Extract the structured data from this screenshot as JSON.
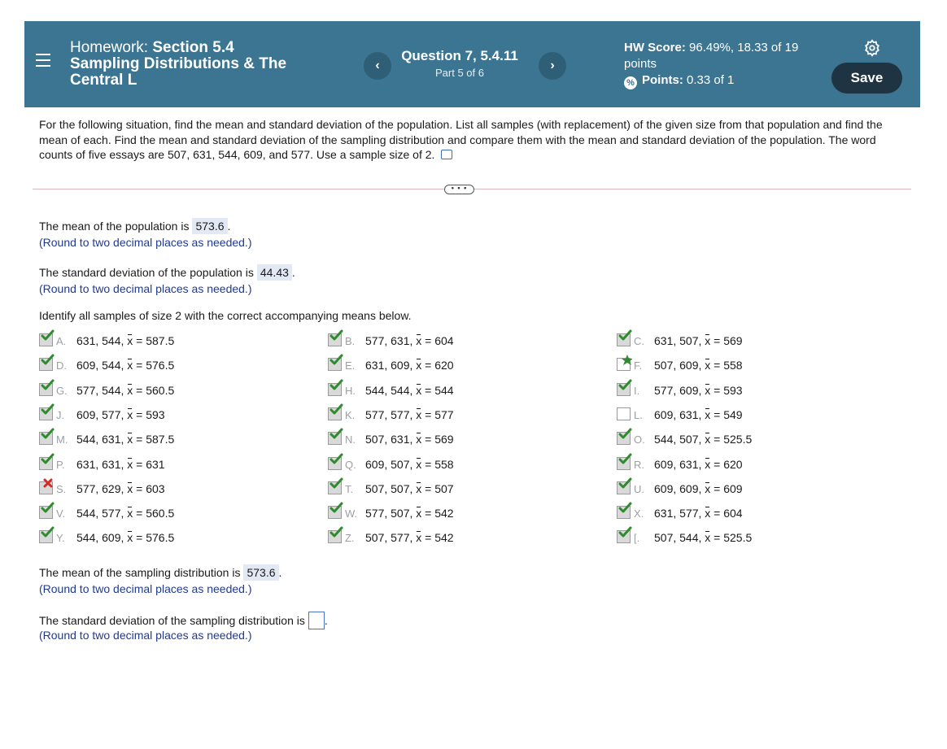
{
  "header": {
    "hw_prefix": "Homework: ",
    "hw_section": "Section 5.4",
    "hw_subtitle": "Sampling Distributions & The Central L",
    "question_title": "Question 7, 5.4.11",
    "question_part": "Part 5 of 6",
    "prev_label": "‹",
    "next_label": "›",
    "score_label": "HW Score:",
    "score_value": "96.49%, 18.33 of 19 points",
    "points_label": "Points:",
    "points_value": "0.33 of 1",
    "save_label": "Save"
  },
  "question_text": "For the following situation, find the mean and standard deviation of the population. List all samples (with replacement) of the given size from that population and find the mean of each. Find the mean and standard deviation of the sampling distribution and compare them with the mean and standard deviation of the population. The word counts of five essays are 507, 631, 544, 609, and 577. Use a sample size of 2.",
  "more_label": "• • •",
  "pop_mean": {
    "prefix": "The mean of the population is",
    "value": "573.6",
    "hint": "(Round to two decimal places as needed.)"
  },
  "pop_sd": {
    "prefix": "The standard deviation of the population is",
    "value": "44.43",
    "hint": "(Round to two decimal places as needed.)"
  },
  "identify_prompt": "Identify all samples of size 2 with the correct accompanying means below.",
  "choices": [
    {
      "letter": "A.",
      "nums": "631, 544,",
      "mean": "= 587.5",
      "state": "checked"
    },
    {
      "letter": "B.",
      "nums": "577, 631,",
      "mean": "= 604",
      "state": "checked"
    },
    {
      "letter": "C.",
      "nums": "631, 507,",
      "mean": "= 569",
      "state": "checked"
    },
    {
      "letter": "D.",
      "nums": "609, 544,",
      "mean": "= 576.5",
      "state": "checked"
    },
    {
      "letter": "E.",
      "nums": "631, 609,",
      "mean": "= 620",
      "state": "checked"
    },
    {
      "letter": "F.",
      "nums": "507, 609,",
      "mean": "= 558",
      "state": "star"
    },
    {
      "letter": "G.",
      "nums": "577, 544,",
      "mean": "= 560.5",
      "state": "checked"
    },
    {
      "letter": "H.",
      "nums": "544, 544,",
      "mean": "= 544",
      "state": "checked"
    },
    {
      "letter": "I.",
      "nums": "577, 609,",
      "mean": "= 593",
      "state": "checked"
    },
    {
      "letter": "J.",
      "nums": "609, 577,",
      "mean": "= 593",
      "state": "checked"
    },
    {
      "letter": "K.",
      "nums": "577, 577,",
      "mean": "= 577",
      "state": "checked"
    },
    {
      "letter": "L.",
      "nums": "609, 631,",
      "mean": "= 549",
      "state": "empty"
    },
    {
      "letter": "M.",
      "nums": "544, 631,",
      "mean": "= 587.5",
      "state": "checked"
    },
    {
      "letter": "N.",
      "nums": "507, 631,",
      "mean": "= 569",
      "state": "checked"
    },
    {
      "letter": "O.",
      "nums": "544, 507,",
      "mean": "= 525.5",
      "state": "checked"
    },
    {
      "letter": "P.",
      "nums": "631, 631,",
      "mean": "= 631",
      "state": "checked"
    },
    {
      "letter": "Q.",
      "nums": "609, 507,",
      "mean": "= 558",
      "state": "checked"
    },
    {
      "letter": "R.",
      "nums": "609, 631,",
      "mean": "= 620",
      "state": "checked"
    },
    {
      "letter": "S.",
      "nums": "577, 629,",
      "mean": "= 603",
      "state": "wrong"
    },
    {
      "letter": "T.",
      "nums": "507, 507,",
      "mean": "= 507",
      "state": "checked"
    },
    {
      "letter": "U.",
      "nums": "609, 609,",
      "mean": "= 609",
      "state": "checked"
    },
    {
      "letter": "V.",
      "nums": "544, 577,",
      "mean": "= 560.5",
      "state": "checked"
    },
    {
      "letter": "W.",
      "nums": "577, 507,",
      "mean": "= 542",
      "state": "checked"
    },
    {
      "letter": "X.",
      "nums": "631, 577,",
      "mean": "= 604",
      "state": "checked"
    },
    {
      "letter": "Y.",
      "nums": "544, 609,",
      "mean": "= 576.5",
      "state": "checked"
    },
    {
      "letter": "Z.",
      "nums": "507, 577,",
      "mean": "= 542",
      "state": "checked"
    },
    {
      "letter": "[.",
      "nums": "507, 544,",
      "mean": "= 525.5",
      "state": "checked"
    }
  ],
  "samp_mean": {
    "prefix": "The mean of the sampling distribution is",
    "value": "573.6",
    "hint": "(Round to two decimal places as needed.)"
  },
  "samp_sd": {
    "prefix": "The standard deviation of the sampling distribution is",
    "value": "",
    "hint": "(Round to two decimal places as needed.)"
  },
  "colors": {
    "header": "#3b7592",
    "check": "#2e8b2e",
    "wrong": "#d42a2a",
    "star": "#2e8b2e",
    "hint": "#1f3a93"
  },
  "icons": {
    "menu": "hamburger-icon",
    "settings": "gear-icon",
    "points": "percent-circle-icon",
    "copy": "copy-icon"
  }
}
